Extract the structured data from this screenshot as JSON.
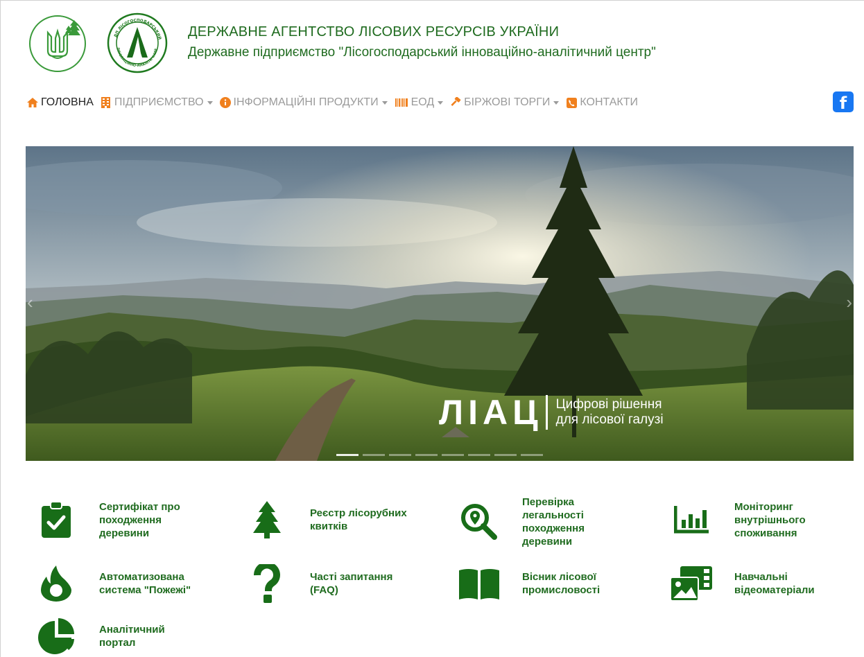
{
  "header": {
    "title_main": "ДЕРЖАВНЕ АГЕНТСТВО ЛІСОВИХ РЕСУРСІВ УКРАЇНИ",
    "title_sub": "Державне підприємство \"Лісогосподарський інноваційно-аналітичний центр\"",
    "logo2_text_top": "ДП ЛІСОГОСПОДАРСЬКИЙ",
    "logo2_text_bottom": "ІННОВАЦІЙНО-АНАЛІТИЧНИЙ ЦЕНТР"
  },
  "nav": {
    "items": [
      {
        "label": "ГОЛОВНА",
        "icon": "home-icon",
        "active": true
      },
      {
        "label": "ПІДПРИЄМСТВО",
        "icon": "building-icon",
        "dropdown": true
      },
      {
        "label": "ІНФОРМАЦІЙНІ ПРОДУКТИ",
        "icon": "info-icon",
        "dropdown": true
      },
      {
        "label": "ЕОД",
        "icon": "barcode-icon",
        "dropdown": true
      },
      {
        "label": "БІРЖОВІ ТОРГИ",
        "icon": "gavel-icon",
        "dropdown": true
      },
      {
        "label": "КОНТАКТИ",
        "icon": "phone-icon"
      }
    ],
    "facebook": "f"
  },
  "carousel": {
    "brand_mark": "ЛІАЦ",
    "tagline_1": "Цифрові рішення",
    "tagline_2": "для лісової галузі",
    "slides_count": 8,
    "active_slide": 1
  },
  "services": [
    {
      "label": "Сертифікат про походження деревини",
      "icon": "clipboard-check-icon"
    },
    {
      "label": "Реєстр лісорубних квитків",
      "icon": "tree-icon"
    },
    {
      "label": "Перевірка легальності походження деревини",
      "icon": "search-location-icon"
    },
    {
      "label": "Моніторинг внутрішнього споживання",
      "icon": "bar-chart-icon"
    },
    {
      "label": "Автоматизована система \"Пожежі\"",
      "icon": "fire-icon"
    },
    {
      "label": "Часті запитання (FAQ)",
      "icon": "question-icon"
    },
    {
      "label": "Вісник лісової промисловості",
      "icon": "book-icon"
    },
    {
      "label": "Навчальні відеоматеріали",
      "icon": "photo-video-icon"
    },
    {
      "label": "Аналітичний портал",
      "icon": "pie-chart-icon"
    }
  ],
  "colors": {
    "brand_green": "#1f6b1f",
    "icon_green": "#186d18",
    "nav_orange": "#f0801e",
    "facebook": "#1877f2"
  }
}
